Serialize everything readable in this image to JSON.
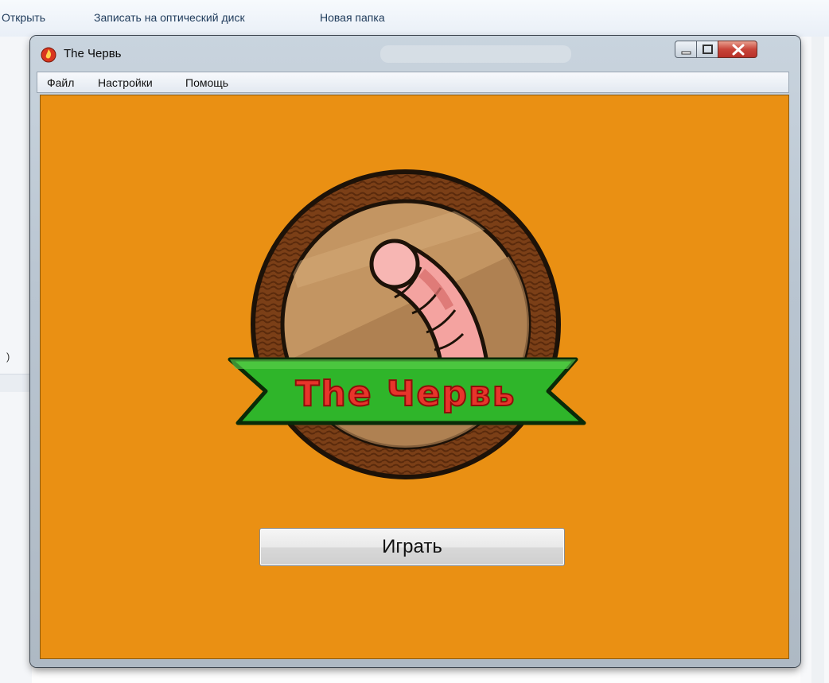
{
  "explorer": {
    "toolbar": {
      "open_label": "Открыть",
      "burn_label": "Записать на оптический диск",
      "new_folder_label": "Новая папка"
    },
    "left_fragment": ")"
  },
  "window": {
    "title": "The Червь",
    "icon": "app-fire-icon",
    "controls": [
      "minimize-icon",
      "maximize-icon",
      "close-icon"
    ]
  },
  "menu": {
    "file": "Файл",
    "settings": "Настройки",
    "help": "Помощь"
  },
  "logo": {
    "banner_text": "The Червь",
    "colors": {
      "background": "#ea9013",
      "rim": "#7a3e18",
      "disc": "#c39562",
      "banner": "#2fb52a",
      "text": "#e8342b",
      "worm": "#f4a3a0"
    }
  },
  "main": {
    "play_button": "Играть"
  }
}
